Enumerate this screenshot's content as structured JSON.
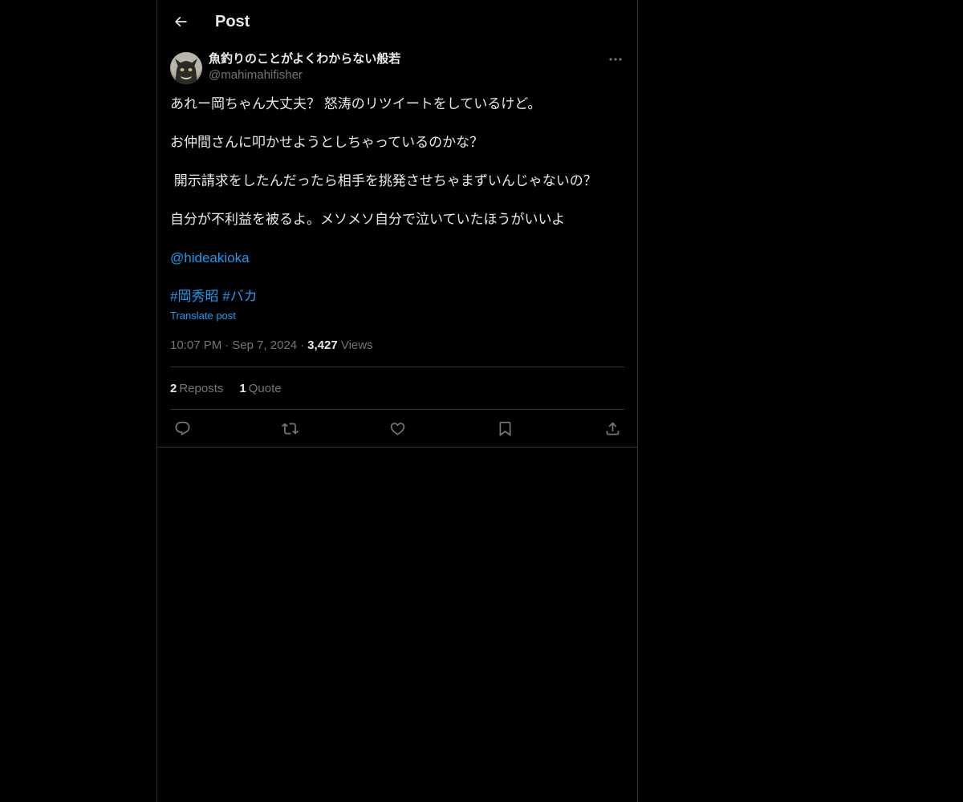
{
  "header": {
    "title": "Post",
    "back_icon": "arrow-left-icon"
  },
  "post": {
    "author": {
      "display_name": "魚釣りのことがよくわからない般若",
      "handle": "@mahimahifisher"
    },
    "paragraphs": [
      "あれー岡ちゃん大丈夫？ 怒涛のリツイートをしているけど。",
      "お仲間さんに叩かせようとしちゃっているのかな？",
      " 開示請求をしたんだったら相手を挑発させちゃまずいんじゃないの？",
      "自分が不利益を被るよ。メソメソ自分で泣いていたほうがいいよ"
    ],
    "mention": "@hideakioka",
    "hashtags": [
      "#岡秀昭",
      "#バカ"
    ],
    "translate_label": "Translate post",
    "time": "10:07 PM",
    "date": "Sep 7, 2024",
    "views_count": "3,427",
    "views_label": "Views",
    "separator": "·"
  },
  "stats": {
    "reposts_count": "2",
    "reposts_label": "Reposts",
    "quotes_count": "1",
    "quotes_label": "Quote"
  },
  "actions": [
    "reply-icon",
    "repost-icon",
    "like-icon",
    "bookmark-icon",
    "share-icon"
  ],
  "colors": {
    "background": "#000000",
    "text": "#e7e9ea",
    "secondary": "#71767b",
    "accent": "#1d9bf0",
    "border": "#2f3336"
  }
}
